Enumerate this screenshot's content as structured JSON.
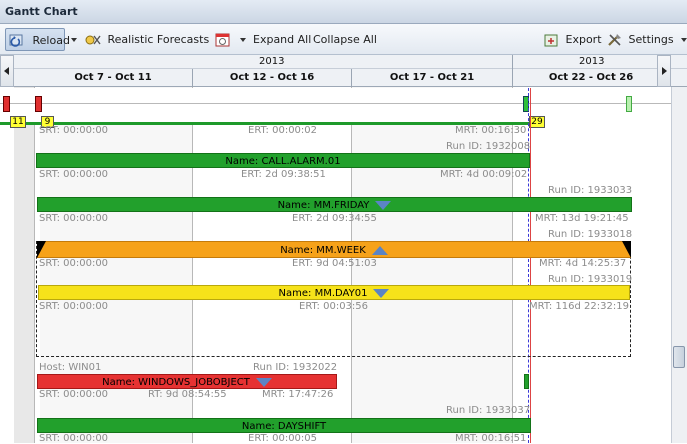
{
  "window": {
    "title": "Gantt Chart"
  },
  "toolbar": {
    "reload": "Reload",
    "forecasts": "Realistic Forecasts",
    "expand_all": "Expand All",
    "collapse_all": "Collapse All",
    "export": "Export",
    "settings": "Settings"
  },
  "timeline": {
    "years": [
      "2013",
      "2013"
    ],
    "weeks": [
      "Oct 7 - Oct 11",
      "Oct 12 - Oct 16",
      "Oct 17 - Oct 21",
      "Oct 22 - Oct 26"
    ]
  },
  "overview": {
    "badges": [
      "11",
      "9",
      "29"
    ]
  },
  "rows": {
    "r0": {
      "srt": "SRT: 00:00:00",
      "ert": "ERT: 00:00:02",
      "mrt": "MRT: 00:16:30",
      "runid": "Run ID: 1932008"
    },
    "alarm": {
      "name": "Name: CALL.ALARM.01",
      "srt": "SRT: 00:00:00",
      "ert": "ERT: 2d 09:38:51",
      "mrt": "MRT: 4d 00:09:02"
    },
    "friday": {
      "runid": "Run ID: 1933033",
      "name": "Name: MM.FRIDAY",
      "srt": "SRT: 00:00:00",
      "ert": "ERT: 2d 09:34:55",
      "mrt": "MRT: 13d 19:21:45"
    },
    "week": {
      "runid": "Run ID: 1933018",
      "name": "Name: MM.WEEK",
      "srt": "SRT: 00:00:00",
      "ert": "ERT: 9d 04:51:03",
      "mrt": "MRT: 4d 14:25:37"
    },
    "day01": {
      "runid": "Run ID: 1933019",
      "name": "Name: MM.DAY01",
      "srt": "SRT: 00:00:00",
      "ert": "ERT: 00:03:56",
      "mrt": "MRT: 116d 22:32:19"
    },
    "jobobject": {
      "host": "Host: WIN01",
      "runid": "Run ID: 1932022",
      "name": "Name: WINDOWS_JOBOBJECT",
      "srt": "SRT: 00:00:00",
      "rt": "RT: 9d 08:54:55",
      "mrt": "MRT: 17:47:26"
    },
    "dayshift": {
      "runid": "Run ID: 1933037",
      "name": "Name: DAYSHIFT",
      "srt": "SRT: 00:00:00",
      "ert": "ERT: 00:00:05",
      "mrt": "MRT: 00:16:51"
    }
  },
  "colors": {
    "green": "#22a02c",
    "orange": "#f6a21a",
    "yellow": "#f6e21a",
    "red": "#e63232",
    "today_line": "#3a3ad8"
  }
}
